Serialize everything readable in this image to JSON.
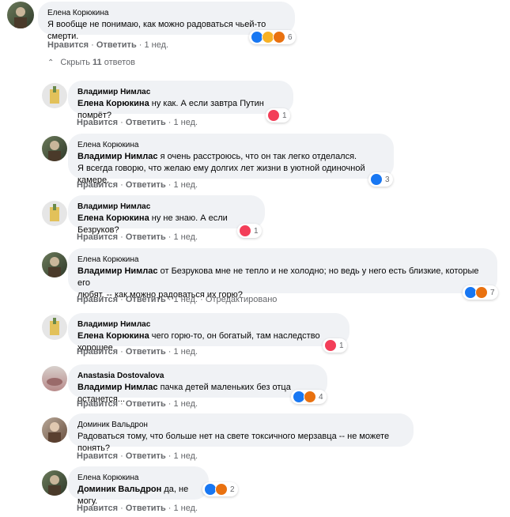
{
  "root": {
    "author": "Елена Корюкина",
    "text": "Я вообще не понимаю, как можно радоваться чьей-то смерти.",
    "reaction_count": "6",
    "like": "Нравится",
    "reply": "Ответить",
    "time": "1 нед."
  },
  "toggle": {
    "prefix": "Скрыть",
    "count": "11",
    "suffix": "ответов"
  },
  "comments": [
    {
      "author": "Владимир Нимлас",
      "mention": "Елена Корюкина",
      "text": " ну как. А если завтра Путин помрёт?",
      "reaction_count": "1",
      "like": "Нравится",
      "reply": "Ответить",
      "time": "1 нед."
    },
    {
      "author": "Елена Корюкина",
      "mention": "Владимир Нимлас",
      "text": " я очень расстроюсь, что он так легко отделался.",
      "text2": "Я всегда говорю, что желаю ему долгих лет жизни в уютной одиночной камере.",
      "reaction_count": "3",
      "like": "Нравится",
      "reply": "Ответить",
      "time": "1 нед."
    },
    {
      "author": "Владимир Нимлас",
      "mention": "Елена Корюкина",
      "text": " ну не знаю. А если Безруков?",
      "reaction_count": "1",
      "like": "Нравится",
      "reply": "Ответить",
      "time": "1 нед."
    },
    {
      "author": "Елена Корюкина",
      "mention": "Владимир Нимлас",
      "text": " от Безрукова мне не тепло и не холодно; но ведь у него есть близкие, которые его",
      "text2": "любят, -- как можно радоваться их горю?",
      "reaction_count": "7",
      "like": "Нравится",
      "reply": "Ответить",
      "time": "1 нед.",
      "edited": "Отредактировано"
    },
    {
      "author": "Владимир Нимлас",
      "mention": "Елена Корюкина",
      "text": " чего горю-то, он богатый, там наследство хорошее",
      "reaction_count": "1",
      "like": "Нравится",
      "reply": "Ответить",
      "time": "1 нед."
    },
    {
      "author": "Anastasia Dostovalova",
      "mention": "Владимир Нимлас",
      "text": " пачка детей маленьких без отца останется...",
      "reaction_count": "4",
      "like": "Нравится",
      "reply": "Ответить",
      "time": "1 нед."
    },
    {
      "author": "Доминик Вальдрон",
      "mention": "",
      "text": "Радоваться тому, что больше нет на свете токсичного мерзавца -- не можете понять?",
      "like": "Нравится",
      "reply": "Ответить",
      "time": "1 нед."
    },
    {
      "author": "Елена Корюкина",
      "mention": "Доминик Вальдрон",
      "text": " да, не могу.",
      "reaction_count": "2",
      "like": "Нравится",
      "reply": "Ответить",
      "time": "1 нед."
    }
  ],
  "colors": {
    "bubble": "#f0f2f5",
    "meta": "#65676b",
    "like": "#1877f2",
    "love": "#f33e58",
    "angry": "#e9710f"
  },
  "icons": [
    "like-reaction-icon",
    "love-reaction-icon",
    "sad-reaction-icon",
    "angry-reaction-icon",
    "chevron-up-icon"
  ]
}
